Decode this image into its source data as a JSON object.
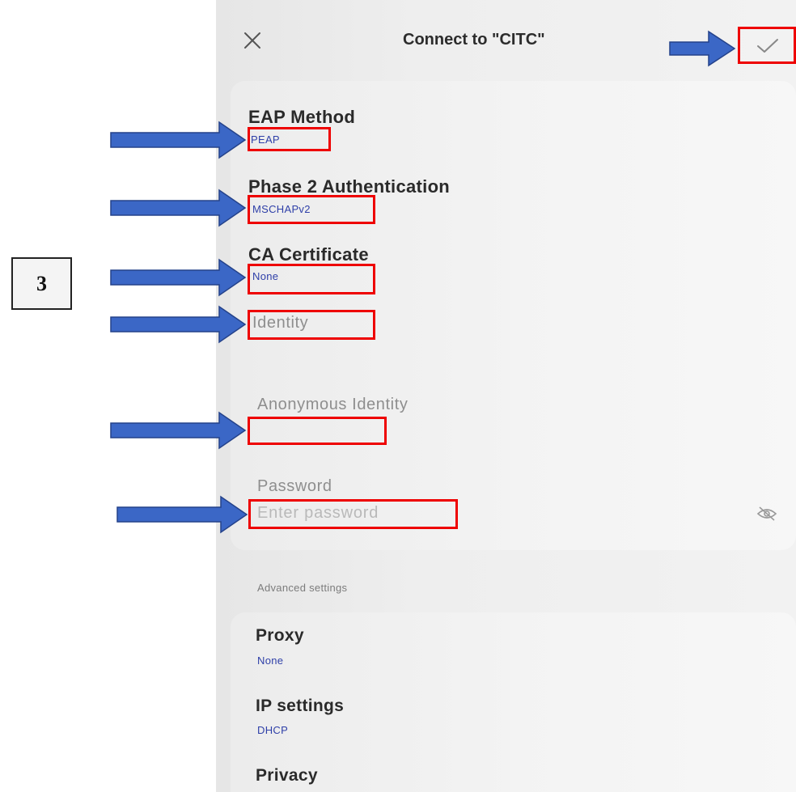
{
  "header": {
    "title": "Connect to \"CITC\""
  },
  "fields": {
    "eap_method": {
      "label": "EAP Method",
      "value": "PEAP"
    },
    "phase2": {
      "label": "Phase 2 Authentication",
      "value": "MSCHAPv2"
    },
    "ca_cert": {
      "label": "CA Certificate",
      "value": "None"
    },
    "identity": {
      "placeholder": "Identity"
    },
    "anon_identity": {
      "label": "Anonymous Identity"
    },
    "password": {
      "label": "Password",
      "placeholder": "Enter password"
    }
  },
  "advanced": {
    "section_label": "Advanced settings",
    "proxy": {
      "label": "Proxy",
      "value": "None"
    },
    "ip": {
      "label": "IP settings",
      "value": "DHCP"
    },
    "privacy": {
      "label": "Privacy"
    }
  },
  "annotation": {
    "step_number": "3"
  },
  "colors": {
    "highlight": "#ee0000",
    "arrow": "#3b67c6",
    "value_text": "#2e3fa8"
  },
  "icons": [
    "close-icon",
    "check-icon",
    "eye-off-icon",
    "arrow-right-icon"
  ]
}
